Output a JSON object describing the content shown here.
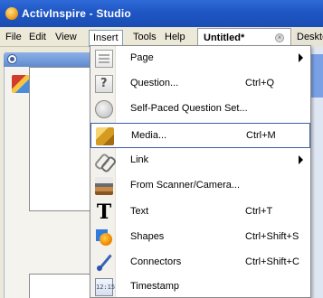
{
  "window": {
    "title": "ActivInspire - Studio"
  },
  "menubar": {
    "items": [
      {
        "label": "File"
      },
      {
        "label": "Edit"
      },
      {
        "label": "View"
      },
      {
        "label": "Insert"
      },
      {
        "label": "Tools"
      },
      {
        "label": "Help"
      }
    ]
  },
  "tabs": {
    "document": "Untitled*",
    "close": "×",
    "desktop_flip": "Desktop Flip"
  },
  "insert_menu": {
    "items": [
      {
        "label": "Page",
        "shortcut": ""
      },
      {
        "label": "Question...",
        "shortcut": "Ctrl+Q"
      },
      {
        "label": "Self-Paced Question Set...",
        "shortcut": ""
      },
      {
        "label": "Media...",
        "shortcut": "Ctrl+M"
      },
      {
        "label": "Link",
        "shortcut": ""
      },
      {
        "label": "From Scanner/Camera...",
        "shortcut": ""
      },
      {
        "label": "Text",
        "shortcut": "Ctrl+T"
      },
      {
        "label": "Shapes",
        "shortcut": "Ctrl+Shift+S"
      },
      {
        "label": "Connectors",
        "shortcut": "Ctrl+Shift+C"
      },
      {
        "label": "Timestamp",
        "shortcut": ""
      }
    ],
    "icons": {
      "text_glyph": "T",
      "timestamp_glyph": "12:15"
    }
  }
}
